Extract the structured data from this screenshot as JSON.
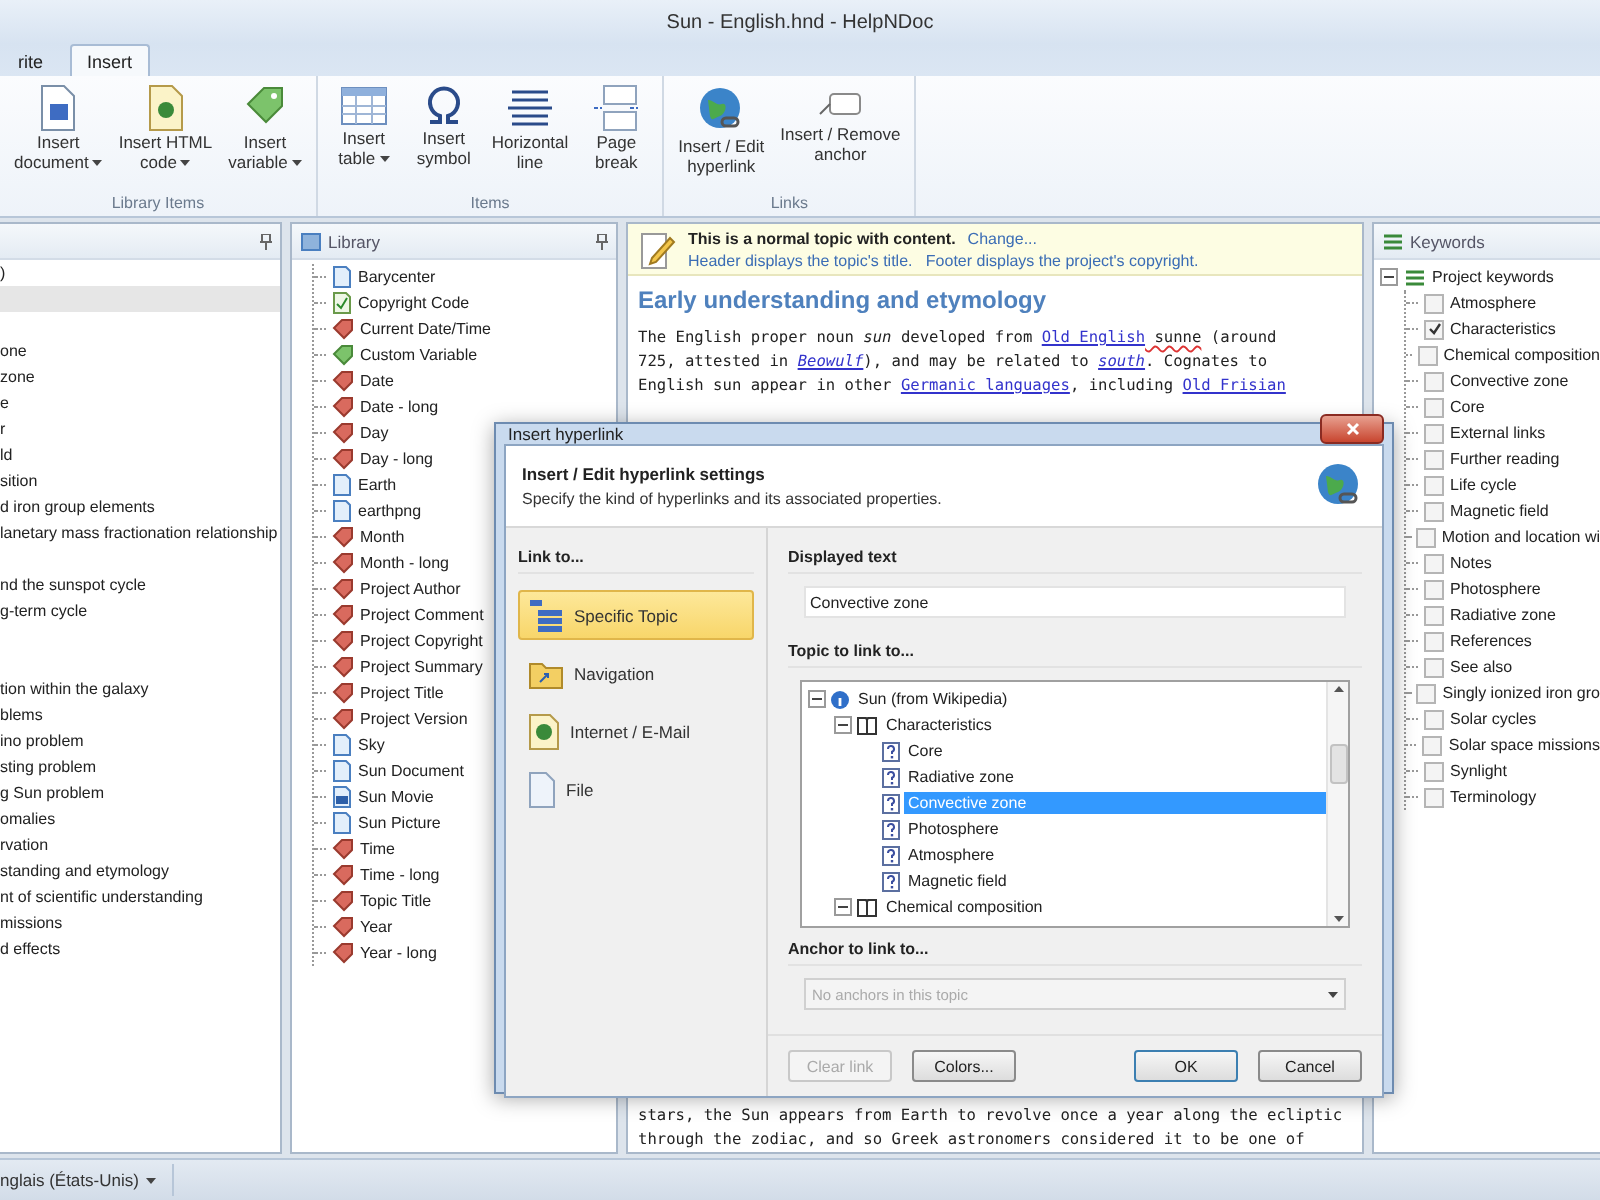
{
  "window": {
    "title": "Sun - English.hnd - HelpNDoc"
  },
  "ribbon": {
    "tabs": [
      {
        "label": "rite",
        "selected": false
      },
      {
        "label": "Insert",
        "selected": true
      }
    ],
    "groups": [
      {
        "label": "Library Items",
        "buttons": [
          {
            "lines": [
              "Insert",
              "document"
            ],
            "dropdown": true,
            "kind": "document"
          },
          {
            "lines": [
              "Insert HTML",
              "code"
            ],
            "dropdown": true,
            "kind": "html"
          },
          {
            "lines": [
              "Insert",
              "variable"
            ],
            "dropdown": true,
            "kind": "variable"
          }
        ]
      },
      {
        "label": "Items",
        "buttons": [
          {
            "lines": [
              "Insert",
              "table"
            ],
            "dropdown": true,
            "kind": "table"
          },
          {
            "lines": [
              "Insert",
              "symbol"
            ],
            "dropdown": false,
            "kind": "symbol"
          },
          {
            "lines": [
              "Horizontal",
              "line"
            ],
            "dropdown": false,
            "kind": "hline"
          },
          {
            "lines": [
              "Page",
              "break"
            ],
            "dropdown": false,
            "kind": "pagebreak"
          }
        ]
      },
      {
        "label": "Links",
        "buttons": [
          {
            "lines": [
              "Insert / Edit",
              "hyperlink"
            ],
            "dropdown": false,
            "kind": "globe"
          },
          {
            "lines": [
              "Insert / Remove",
              "anchor"
            ],
            "dropdown": false,
            "kind": "anchor"
          }
        ]
      }
    ]
  },
  "topics": {
    "items": [
      {
        "label": ")",
        "selected": false
      },
      {
        "selected": true
      },
      {
        "selected": false
      },
      {
        "label": "one",
        "selected": false
      },
      {
        "label": "zone",
        "selected": false
      },
      {
        "label": "e",
        "selected": false
      },
      {
        "label": "r",
        "selected": false
      },
      {
        "label": "ld",
        "selected": false
      },
      {
        "label": "sition",
        "selected": false
      },
      {
        "label": "d iron group elements",
        "selected": false
      },
      {
        "label": "lanetary mass fractionation relationship",
        "selected": false
      },
      {
        "selected": false
      },
      {
        "label": "nd the sunspot cycle",
        "selected": false
      },
      {
        "label": "g-term cycle",
        "selected": false
      },
      {
        "selected": false
      },
      {
        "selected": false
      },
      {
        "label": "tion within the galaxy",
        "selected": false
      },
      {
        "label": "blems",
        "selected": false
      },
      {
        "label": "ino problem",
        "selected": false
      },
      {
        "label": "sting problem",
        "selected": false
      },
      {
        "label": "g Sun problem",
        "selected": false
      },
      {
        "label": "omalies",
        "selected": false
      },
      {
        "label": "rvation",
        "selected": false
      },
      {
        "label": "standing and etymology",
        "selected": false
      },
      {
        "label": "nt of scientific understanding",
        "selected": false
      },
      {
        "label": " missions",
        "selected": false
      },
      {
        "label": "d effects",
        "selected": false
      }
    ]
  },
  "library": {
    "title": "Library",
    "items": [
      {
        "label": "Barycenter",
        "kind": "document"
      },
      {
        "label": "Copyright Code",
        "kind": "code"
      },
      {
        "label": "Current Date/Time",
        "kind": "variable"
      },
      {
        "label": "Custom Variable",
        "kind": "custom"
      },
      {
        "label": "Date",
        "kind": "variable"
      },
      {
        "label": "Date - long",
        "kind": "variable"
      },
      {
        "label": "Day",
        "kind": "variable"
      },
      {
        "label": "Day - long",
        "kind": "variable"
      },
      {
        "label": "Earth",
        "kind": "document"
      },
      {
        "label": "earthpng",
        "kind": "document"
      },
      {
        "label": "Month",
        "kind": "variable"
      },
      {
        "label": "Month - long",
        "kind": "variable"
      },
      {
        "label": "Project Author",
        "kind": "variable"
      },
      {
        "label": "Project Comment",
        "kind": "variable"
      },
      {
        "label": "Project Copyright",
        "kind": "variable"
      },
      {
        "label": "Project Summary",
        "kind": "variable"
      },
      {
        "label": "Project Title",
        "kind": "variable"
      },
      {
        "label": "Project Version",
        "kind": "variable"
      },
      {
        "label": "Sky",
        "kind": "document"
      },
      {
        "label": "Sun Document",
        "kind": "document"
      },
      {
        "label": "Sun Movie",
        "kind": "movie"
      },
      {
        "label": "Sun Picture",
        "kind": "document"
      },
      {
        "label": "Time",
        "kind": "variable"
      },
      {
        "label": "Time - long",
        "kind": "variable"
      },
      {
        "label": "Topic Title",
        "kind": "variable"
      },
      {
        "label": "Year",
        "kind": "variable"
      },
      {
        "label": "Year - long",
        "kind": "variable"
      }
    ]
  },
  "editor": {
    "banner": {
      "title": "This is a normal topic with content.",
      "link": "Change...",
      "note": "Header displays the topic's title.   Footer displays the project's copyright."
    },
    "heading": "Early understanding and etymology",
    "paragraphs": [
      {
        "lines": [
          [
            {
              "text": "The English proper noun ",
              "kind": "plain"
            },
            {
              "text": "sun",
              "kind": "italic"
            },
            {
              "text": " developed from ",
              "kind": "plain"
            },
            {
              "text": "Old English",
              "kind": "link"
            },
            {
              "text": " sunne",
              "kind": "misspelled"
            },
            {
              "text": " (around",
              "kind": "plain"
            }
          ],
          [
            {
              "text": "725, attested in ",
              "kind": "plain"
            },
            {
              "text": "Beowulf",
              "kind": "italic-link"
            },
            {
              "text": "), and may be related to ",
              "kind": "plain"
            },
            {
              "text": "south",
              "kind": "italic-link"
            },
            {
              "text": ". Cognates to",
              "kind": "plain"
            }
          ],
          [
            {
              "text": "English sun appear in other ",
              "kind": "plain"
            },
            {
              "text": "Germanic languages",
              "kind": "link"
            },
            {
              "text": ", including ",
              "kind": "plain"
            },
            {
              "text": "Old Frisian",
              "kind": "link"
            }
          ]
        ]
      },
      {
        "lines": [
          [
            {
              "text": "stars, the Sun appears from Earth to revolve once a year along the ecliptic",
              "kind": "plain"
            }
          ],
          [
            {
              "text": "through the zodiac, and so Greek astronomers considered it to be one of",
              "kind": "plain"
            }
          ]
        ]
      }
    ]
  },
  "keywords": {
    "title": "Keywords",
    "root": {
      "label": "Project keywords",
      "expanded": true,
      "children": [
        {
          "label": "Atmosphere",
          "checked": false
        },
        {
          "label": "Characteristics",
          "checked": true
        },
        {
          "label": "Chemical composition",
          "checked": false
        },
        {
          "label": "Convective zone",
          "checked": false
        },
        {
          "label": "Core",
          "checked": false
        },
        {
          "label": "External links",
          "checked": false
        },
        {
          "label": "Further reading",
          "checked": false
        },
        {
          "label": "Life cycle",
          "checked": false
        },
        {
          "label": "Magnetic field",
          "checked": false
        },
        {
          "label": "Motion and location wi",
          "checked": false
        },
        {
          "label": "Notes",
          "checked": false
        },
        {
          "label": "Photosphere",
          "checked": false
        },
        {
          "label": "Radiative zone",
          "checked": false
        },
        {
          "label": "References",
          "checked": false
        },
        {
          "label": "See also",
          "checked": false
        },
        {
          "label": "Singly ionized iron gro",
          "checked": false
        },
        {
          "label": "Solar cycles",
          "checked": false
        },
        {
          "label": "Solar space missions",
          "checked": false
        },
        {
          "label": "Synlight",
          "checked": false
        },
        {
          "label": "Terminology",
          "checked": false
        }
      ]
    }
  },
  "dialog": {
    "title": "Insert hyperlink",
    "heading": "Insert / Edit hyperlink settings",
    "subheading": "Specify the kind of hyperlinks and its associated properties.",
    "link_to": {
      "label": "Link to...",
      "options": [
        {
          "label": "Specific Topic",
          "kind": "topic",
          "selected": true
        },
        {
          "label": "Navigation",
          "kind": "navigation",
          "selected": false
        },
        {
          "label": "Internet / E-Mail",
          "kind": "internet",
          "selected": false
        },
        {
          "label": "File",
          "kind": "file",
          "selected": false
        }
      ]
    },
    "displayed_text": {
      "label": "Displayed text",
      "value": "Convective zone"
    },
    "topic": {
      "label": "Topic to link to...",
      "tree": [
        {
          "label": "Sun (from Wikipedia)",
          "kind": "project",
          "expanded": true,
          "selected": false,
          "children": [
            {
              "label": "Characteristics",
              "kind": "book",
              "expanded": true,
              "selected": false,
              "children": [
                {
                  "label": "Core",
                  "kind": "topic",
                  "selected": false
                },
                {
                  "label": "Radiative zone",
                  "kind": "topic",
                  "selected": false
                },
                {
                  "label": "Convective zone",
                  "kind": "topic",
                  "selected": true
                },
                {
                  "label": "Photosphere",
                  "kind": "topic",
                  "selected": false
                },
                {
                  "label": "Atmosphere",
                  "kind": "topic",
                  "selected": false
                },
                {
                  "label": "Magnetic field",
                  "kind": "topic",
                  "selected": false
                }
              ]
            },
            {
              "label": "Chemical composition",
              "kind": "book",
              "expanded": true,
              "selected": false
            }
          ]
        }
      ]
    },
    "anchor": {
      "label": "Anchor to link to...",
      "placeholder": "No anchors in this topic",
      "disabled": true
    },
    "buttons": [
      {
        "label": "Clear link",
        "disabled": true,
        "default": false
      },
      {
        "label": "Colors...",
        "disabled": false,
        "default": false
      },
      {
        "label": "OK",
        "disabled": false,
        "default": true
      },
      {
        "label": "Cancel",
        "disabled": false,
        "default": false
      }
    ]
  },
  "status_bar": {
    "language": "nglais (États-Unis)"
  }
}
